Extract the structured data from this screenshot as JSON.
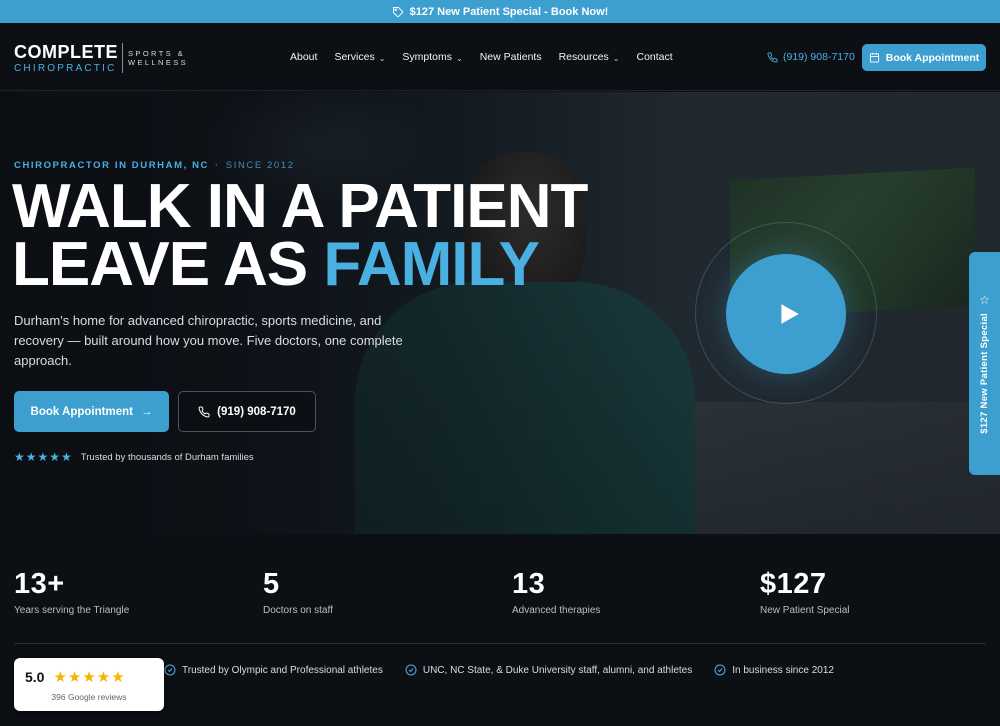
{
  "promo": {
    "text": "$127 New Patient Special - Book Now!",
    "icon": "tag-icon"
  },
  "brand": {
    "line1": "COMPLETE",
    "line2": "CHIROPRACTIC",
    "side1": "SPORTS &",
    "side2": "WELLNESS"
  },
  "nav": {
    "items": [
      {
        "label": "About",
        "dropdown": false
      },
      {
        "label": "Services",
        "dropdown": true
      },
      {
        "label": "Symptoms",
        "dropdown": true
      },
      {
        "label": "New Patients",
        "dropdown": false
      },
      {
        "label": "Resources",
        "dropdown": true
      },
      {
        "label": "Contact",
        "dropdown": false
      }
    ],
    "phone": "(919) 908-7170",
    "book_label": "Book Appointment"
  },
  "hero": {
    "eyebrow_main": "CHIROPRACTOR IN DURHAM, NC",
    "eyebrow_since": "SINCE 2012",
    "headline_line1": "WALK IN A PATIENT",
    "headline_line2_prefix": "LEAVE AS ",
    "headline_line2_accent": "FAMILY",
    "subtext": "Durham's home for advanced chiropractic, sports medicine, and recovery — built around how you move. Five doctors, one complete approach.",
    "primary_cta": "Book Appointment",
    "phone_cta": "(919) 908-7170",
    "trust_stars": "★★★★★",
    "trust_text": "Trusted by thousands of Durham families"
  },
  "side_tab": {
    "label": "$127 New Patient Special"
  },
  "stats": [
    {
      "value": "13+",
      "label": "Years serving the Triangle"
    },
    {
      "value": "5",
      "label": "Doctors on staff"
    },
    {
      "value": "13",
      "label": "Advanced therapies"
    },
    {
      "value": "$127",
      "label": "New Patient Special"
    }
  ],
  "badges": [
    "Trusted by Olympic and Professional athletes",
    "UNC, NC State, & Duke University staff, alumni, and athletes",
    "In business since 2012"
  ],
  "review": {
    "score": "5.0",
    "stars": "★★★★★",
    "count": "396 Google reviews"
  },
  "colors": {
    "accent": "#3d9fd0",
    "background": "#0c0f13",
    "star": "#f4b400"
  }
}
